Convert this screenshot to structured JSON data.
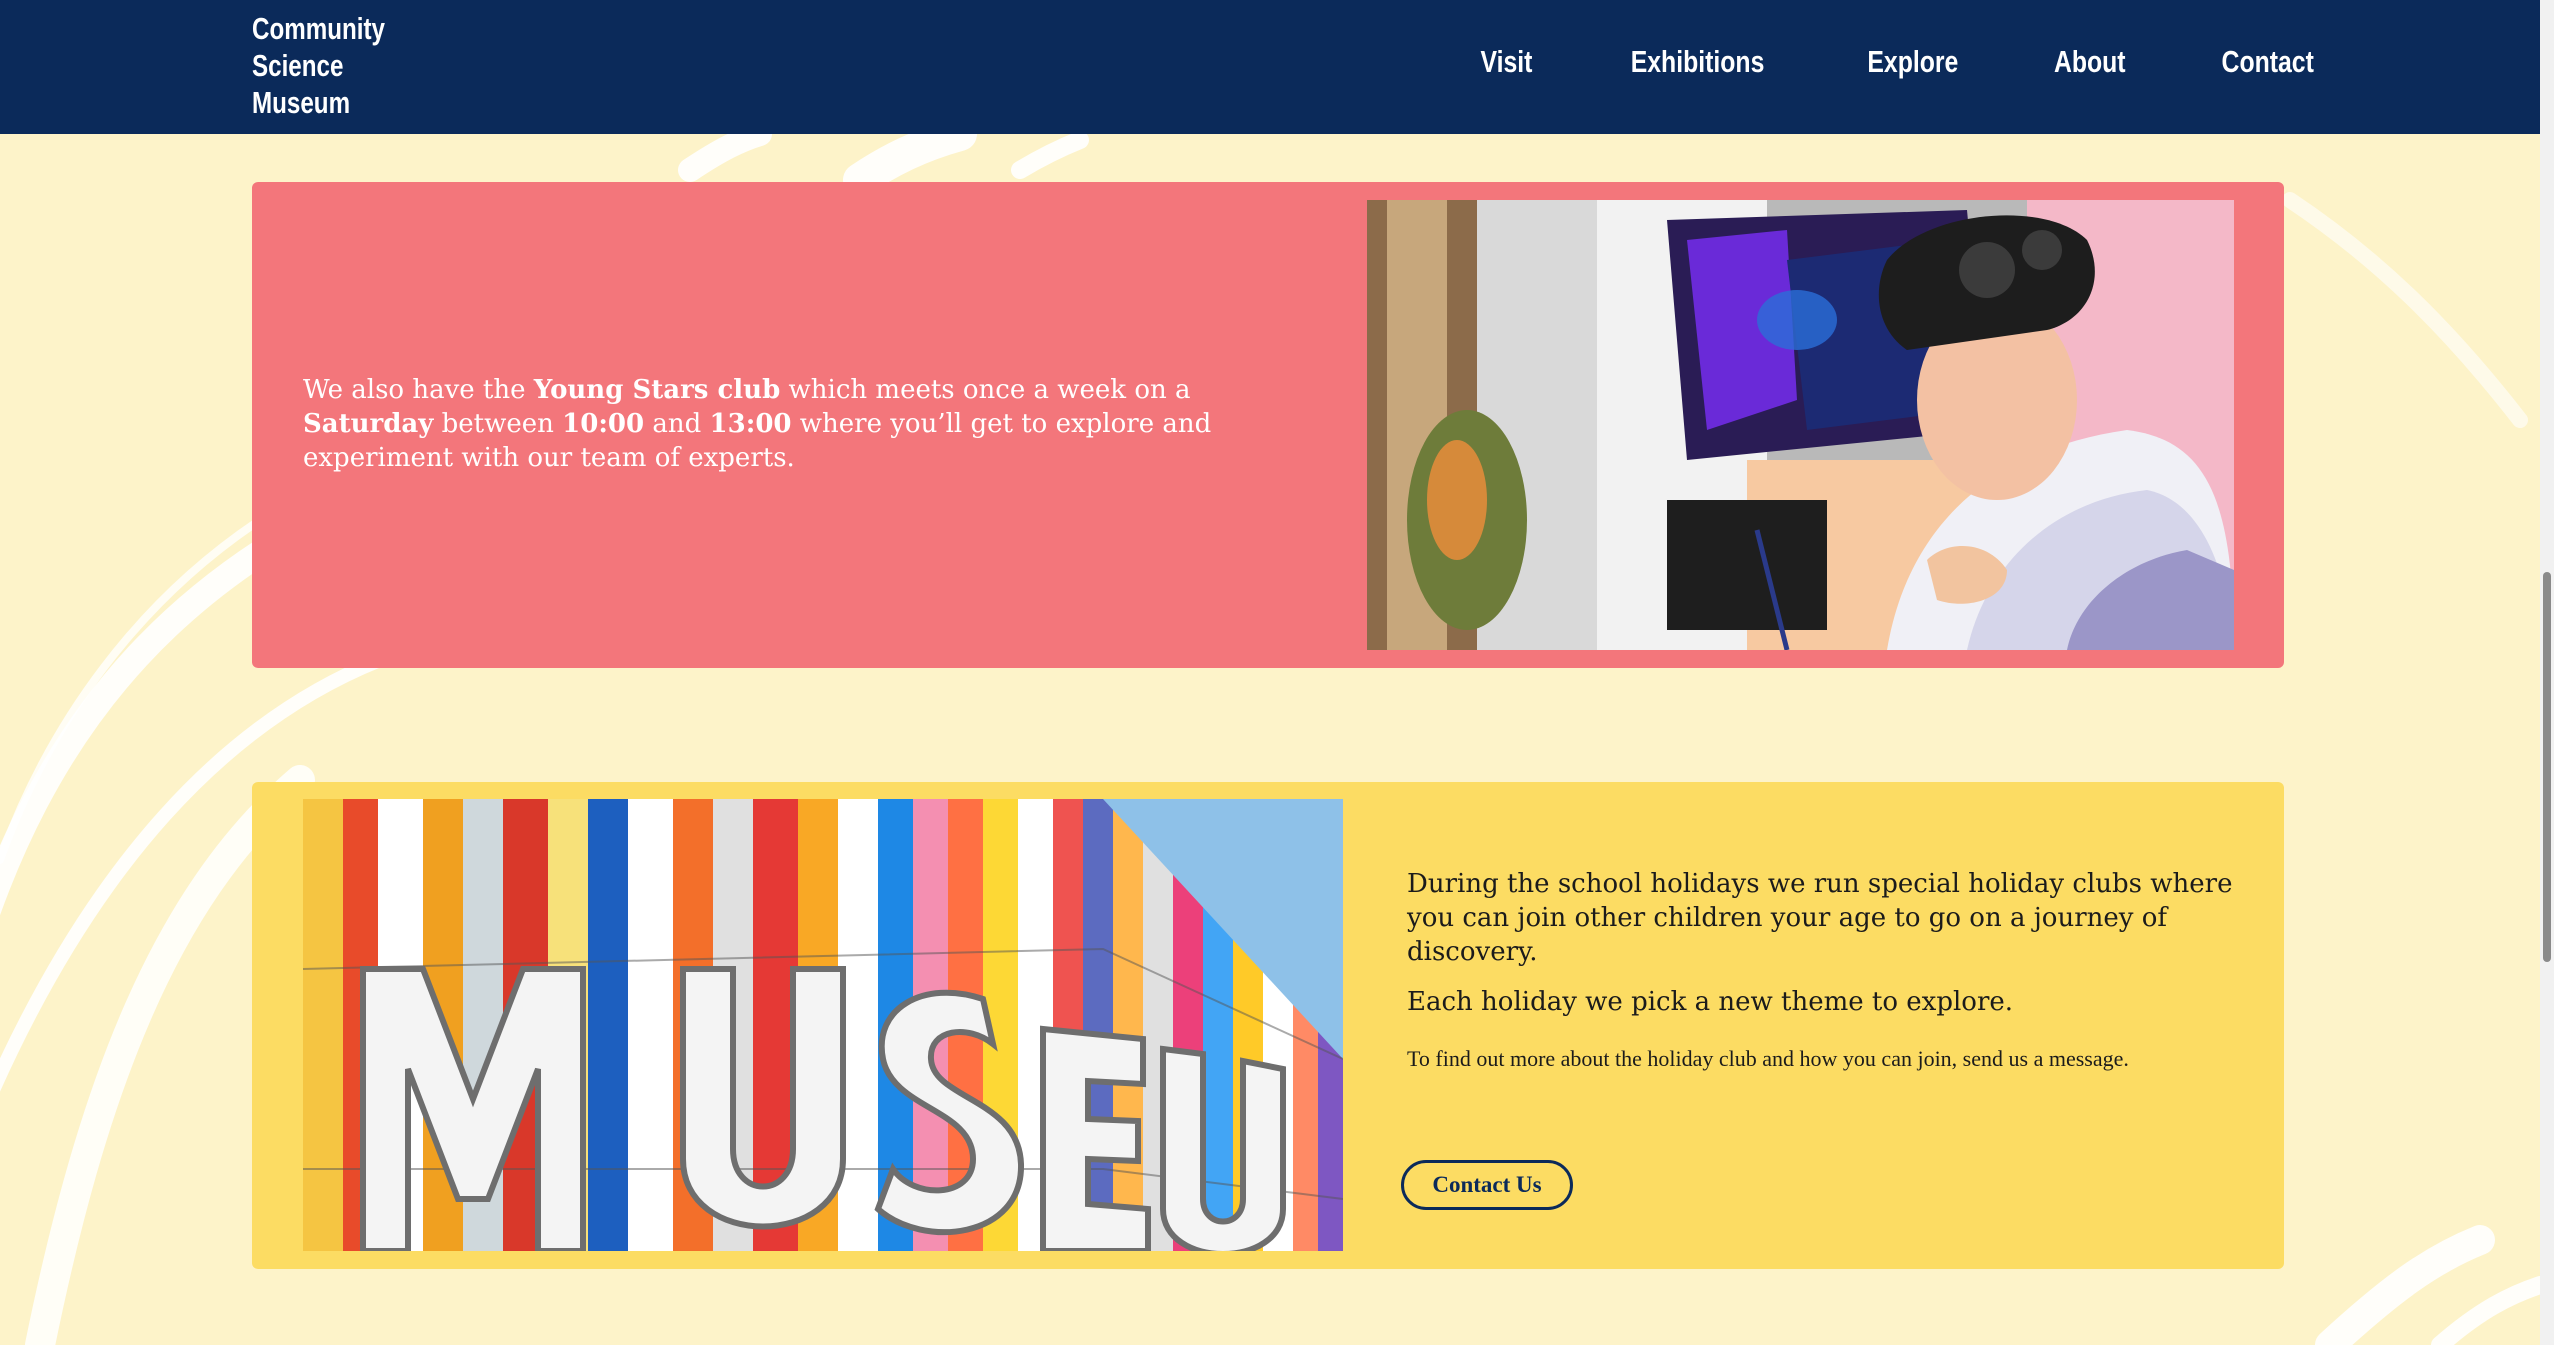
{
  "logo": {
    "line1": "Community",
    "line2": "Science",
    "line3": "Museum"
  },
  "nav": [
    {
      "label": "Visit"
    },
    {
      "label": "Exhibitions"
    },
    {
      "label": "Explore"
    },
    {
      "label": "About"
    },
    {
      "label": "Contact"
    }
  ],
  "young_stars": {
    "t1": "We also have the ",
    "b1": "Young Stars club",
    "t2": " which meets once a week on a ",
    "b2": "Saturday",
    "t3": " between ",
    "b3": "10:00",
    "t4": " and ",
    "b4": "13:00",
    "t5": " where you’ll get to explore and experiment with our team of experts."
  },
  "holiday": {
    "p1": "During the school holidays we run special holiday clubs where you can join other children your age to go on a journey of discovery.",
    "p2": "Each holiday we pick a new theme to explore.",
    "p3": "To find out more about the holiday club and how you can join, send us a message.",
    "button": "Contact Us"
  },
  "colors": {
    "navbar": "#0b2a5a",
    "background": "#fdf3c9",
    "pink_card": "#f3767b",
    "yellow_card": "#fcdc63"
  }
}
